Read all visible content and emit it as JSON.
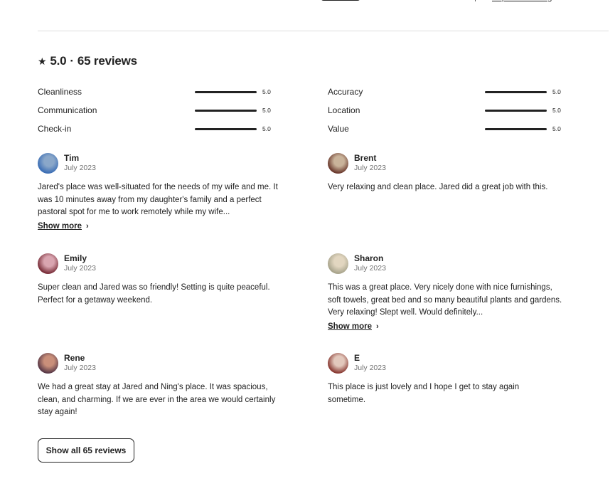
{
  "top": {
    "report_link": "Report this listing"
  },
  "summary": {
    "star_icon": "star-icon",
    "rating": "5.0",
    "separator": "·",
    "reviews_count_label": "65 reviews"
  },
  "categories": [
    {
      "label": "Cleanliness",
      "value": "5.0",
      "fraction": 1.0
    },
    {
      "label": "Communication",
      "value": "5.0",
      "fraction": 1.0
    },
    {
      "label": "Check-in",
      "value": "5.0",
      "fraction": 1.0
    },
    {
      "label": "Accuracy",
      "value": "5.0",
      "fraction": 1.0
    },
    {
      "label": "Location",
      "value": "5.0",
      "fraction": 1.0
    },
    {
      "label": "Value",
      "value": "5.0",
      "fraction": 1.0
    }
  ],
  "reviews": [
    {
      "name": "Tim",
      "date": "July 2023",
      "text": "Jared's place was well-situated for the needs of my wife and me. It was 10 minutes away from my daughter's family and a perfect pastoral spot for me to work remotely while my wife...",
      "show_more": "Show more",
      "avatar_colors": [
        "#3d6fb5",
        "#8aa7c9"
      ]
    },
    {
      "name": "Brent",
      "date": "July 2023",
      "text": "Very relaxing and clean place. Jared did a great job with this.",
      "avatar_colors": [
        "#6b3a2e",
        "#c9b39a"
      ]
    },
    {
      "name": "Emily",
      "date": "July 2023",
      "text": "Super clean and Jared was so friendly! Setting is quite peaceful. Perfect for a getaway weekend.",
      "avatar_colors": [
        "#7a2f3a",
        "#d9a5b0"
      ]
    },
    {
      "name": "Sharon",
      "date": "July 2023",
      "text": "This was a great place. Very nicely done with nice furnishings, soft towels, great bed and so many beautiful plants and gardens. Very relaxing! Slept well. Would definitely...",
      "show_more": "Show more",
      "avatar_colors": [
        "#a8a48c",
        "#e2d6c0"
      ]
    },
    {
      "name": "Rene",
      "date": "July 2023",
      "text": "We had a great stay at Jared and Ning's place. It was spacious, clean, and charming. If we are ever in the area we would certainly stay again!",
      "avatar_colors": [
        "#5a3a48",
        "#c98f7a"
      ]
    },
    {
      "name": "E",
      "date": "July 2023",
      "text": "This place is just lovely and I hope I get to stay again sometime.",
      "avatar_colors": [
        "#8a3b34",
        "#e2c8bc"
      ]
    }
  ],
  "show_all_button": "Show all 65 reviews"
}
